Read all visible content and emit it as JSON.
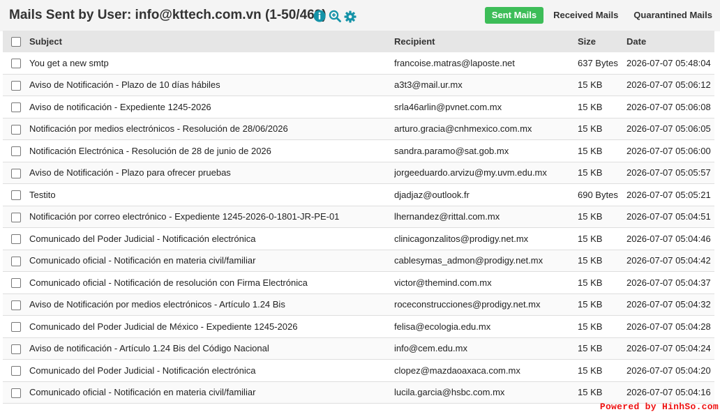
{
  "header": {
    "title": "Mails Sent by User: info@kttech.com.vn (1-50/469)",
    "icons": [
      "info-icon",
      "zoom-icon",
      "gear-icon"
    ],
    "tabs": [
      {
        "label": "Sent Mails",
        "active": true
      },
      {
        "label": "Received Mails",
        "active": false
      },
      {
        "label": "Quarantined Mails",
        "active": false
      }
    ]
  },
  "colors": {
    "accent_green": "#3dbd58",
    "icon_teal": "#1593a8",
    "watermark_red": "#ee1111"
  },
  "table": {
    "columns": [
      "Subject",
      "Recipient",
      "Size",
      "Date"
    ],
    "rows": [
      {
        "subject": "You get a new smtp",
        "recipient": "francoise.matras@laposte.net",
        "size": "637 Bytes",
        "date": "2026-07-07 05:48:04"
      },
      {
        "subject": "Aviso de Notificación - Plazo de 10 días hábiles",
        "recipient": "a3t3@mail.ur.mx",
        "size": "15 KB",
        "date": "2026-07-07 05:06:12"
      },
      {
        "subject": "Aviso de notificación - Expediente 1245-2026",
        "recipient": "srla46arlin@pvnet.com.mx",
        "size": "15 KB",
        "date": "2026-07-07 05:06:08"
      },
      {
        "subject": "Notificación por medios electrónicos - Resolución de 28/06/2026",
        "recipient": "arturo.gracia@cnhmexico.com.mx",
        "size": "15 KB",
        "date": "2026-07-07 05:06:05"
      },
      {
        "subject": "Notificación Electrónica - Resolución de 28 de junio de 2026",
        "recipient": "sandra.paramo@sat.gob.mx",
        "size": "15 KB",
        "date": "2026-07-07 05:06:00"
      },
      {
        "subject": "Aviso de Notificación - Plazo para ofrecer pruebas",
        "recipient": "jorgeeduardo.arvizu@my.uvm.edu.mx",
        "size": "15 KB",
        "date": "2026-07-07 05:05:57"
      },
      {
        "subject": "Testito",
        "recipient": "djadjaz@outlook.fr",
        "size": "690 Bytes",
        "date": "2026-07-07 05:05:21"
      },
      {
        "subject": "Notificación por correo electrónico - Expediente 1245-2026-0-1801-JR-PE-01",
        "recipient": "lhernandez@rittal.com.mx",
        "size": "15 KB",
        "date": "2026-07-07 05:04:51"
      },
      {
        "subject": "Comunicado del Poder Judicial - Notificación electrónica",
        "recipient": "clinicagonzalitos@prodigy.net.mx",
        "size": "15 KB",
        "date": "2026-07-07 05:04:46"
      },
      {
        "subject": "Comunicado oficial - Notificación en materia civil/familiar",
        "recipient": "cablesymas_admon@prodigy.net.mx",
        "size": "15 KB",
        "date": "2026-07-07 05:04:42"
      },
      {
        "subject": "Comunicado oficial - Notificación de resolución con Firma Electrónica",
        "recipient": "victor@themind.com.mx",
        "size": "15 KB",
        "date": "2026-07-07 05:04:37"
      },
      {
        "subject": "Aviso de Notificación por medios electrónicos - Artículo 1.24 Bis",
        "recipient": "roceconstrucciones@prodigy.net.mx",
        "size": "15 KB",
        "date": "2026-07-07 05:04:32"
      },
      {
        "subject": "Comunicado del Poder Judicial de México - Expediente 1245-2026",
        "recipient": "felisa@ecologia.edu.mx",
        "size": "15 KB",
        "date": "2026-07-07 05:04:28"
      },
      {
        "subject": "Aviso de notificación - Artículo 1.24 Bis del Código Nacional",
        "recipient": "info@cem.edu.mx",
        "size": "15 KB",
        "date": "2026-07-07 05:04:24"
      },
      {
        "subject": "Comunicado del Poder Judicial - Notificación electrónica",
        "recipient": "clopez@mazdaoaxaca.com.mx",
        "size": "15 KB",
        "date": "2026-07-07 05:04:20"
      },
      {
        "subject": "Comunicado oficial - Notificación en materia civil/familiar",
        "recipient": "lucila.garcia@hsbc.com.mx",
        "size": "15 KB",
        "date": "2026-07-07 05:04:16"
      }
    ]
  },
  "watermark": "Powered by HinhSo.com"
}
